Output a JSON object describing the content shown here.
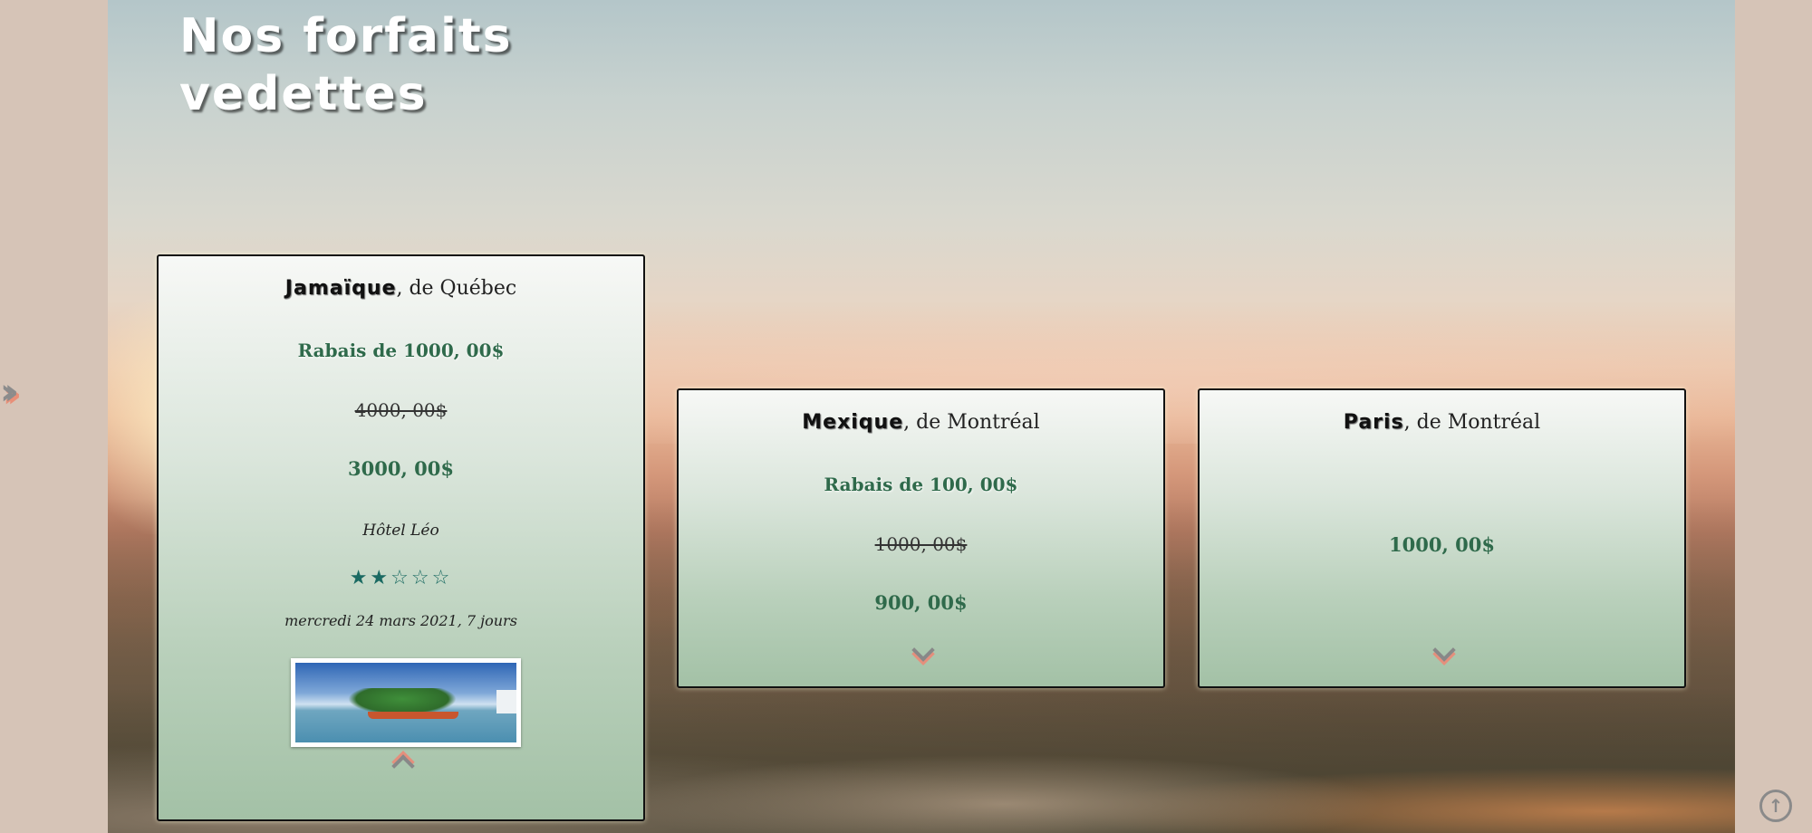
{
  "page": {
    "title": "Nos forfaits vedettes",
    "side_nav_icon": "double-chevron-right-icon",
    "scroll_top_icon": "arrow-up-circle-icon"
  },
  "colors": {
    "accent_green": "#2f6a4b",
    "star_color": "#1a6a62",
    "chevron_shadow": "#e58f7c"
  },
  "packages": [
    {
      "destination": "Jamaïque",
      "departure": ", de Québec",
      "discount": "Rabais de 1000, 00$",
      "old_price": "4000, 00$",
      "new_price": "3000, 00$",
      "hotel": "Hôtel Léo",
      "stars_display": "★★☆☆☆",
      "rating": 2,
      "rating_max": 5,
      "date": "mercredi 24 mars 2021, 7 jours",
      "expanded": true
    },
    {
      "destination": "Mexique",
      "departure": ", de Montréal",
      "discount": "Rabais de 100, 00$",
      "old_price": "1000, 00$",
      "new_price": "900, 00$",
      "expanded": false
    },
    {
      "destination": "Paris",
      "departure": ", de Montréal",
      "price": "1000, 00$",
      "expanded": false
    }
  ]
}
